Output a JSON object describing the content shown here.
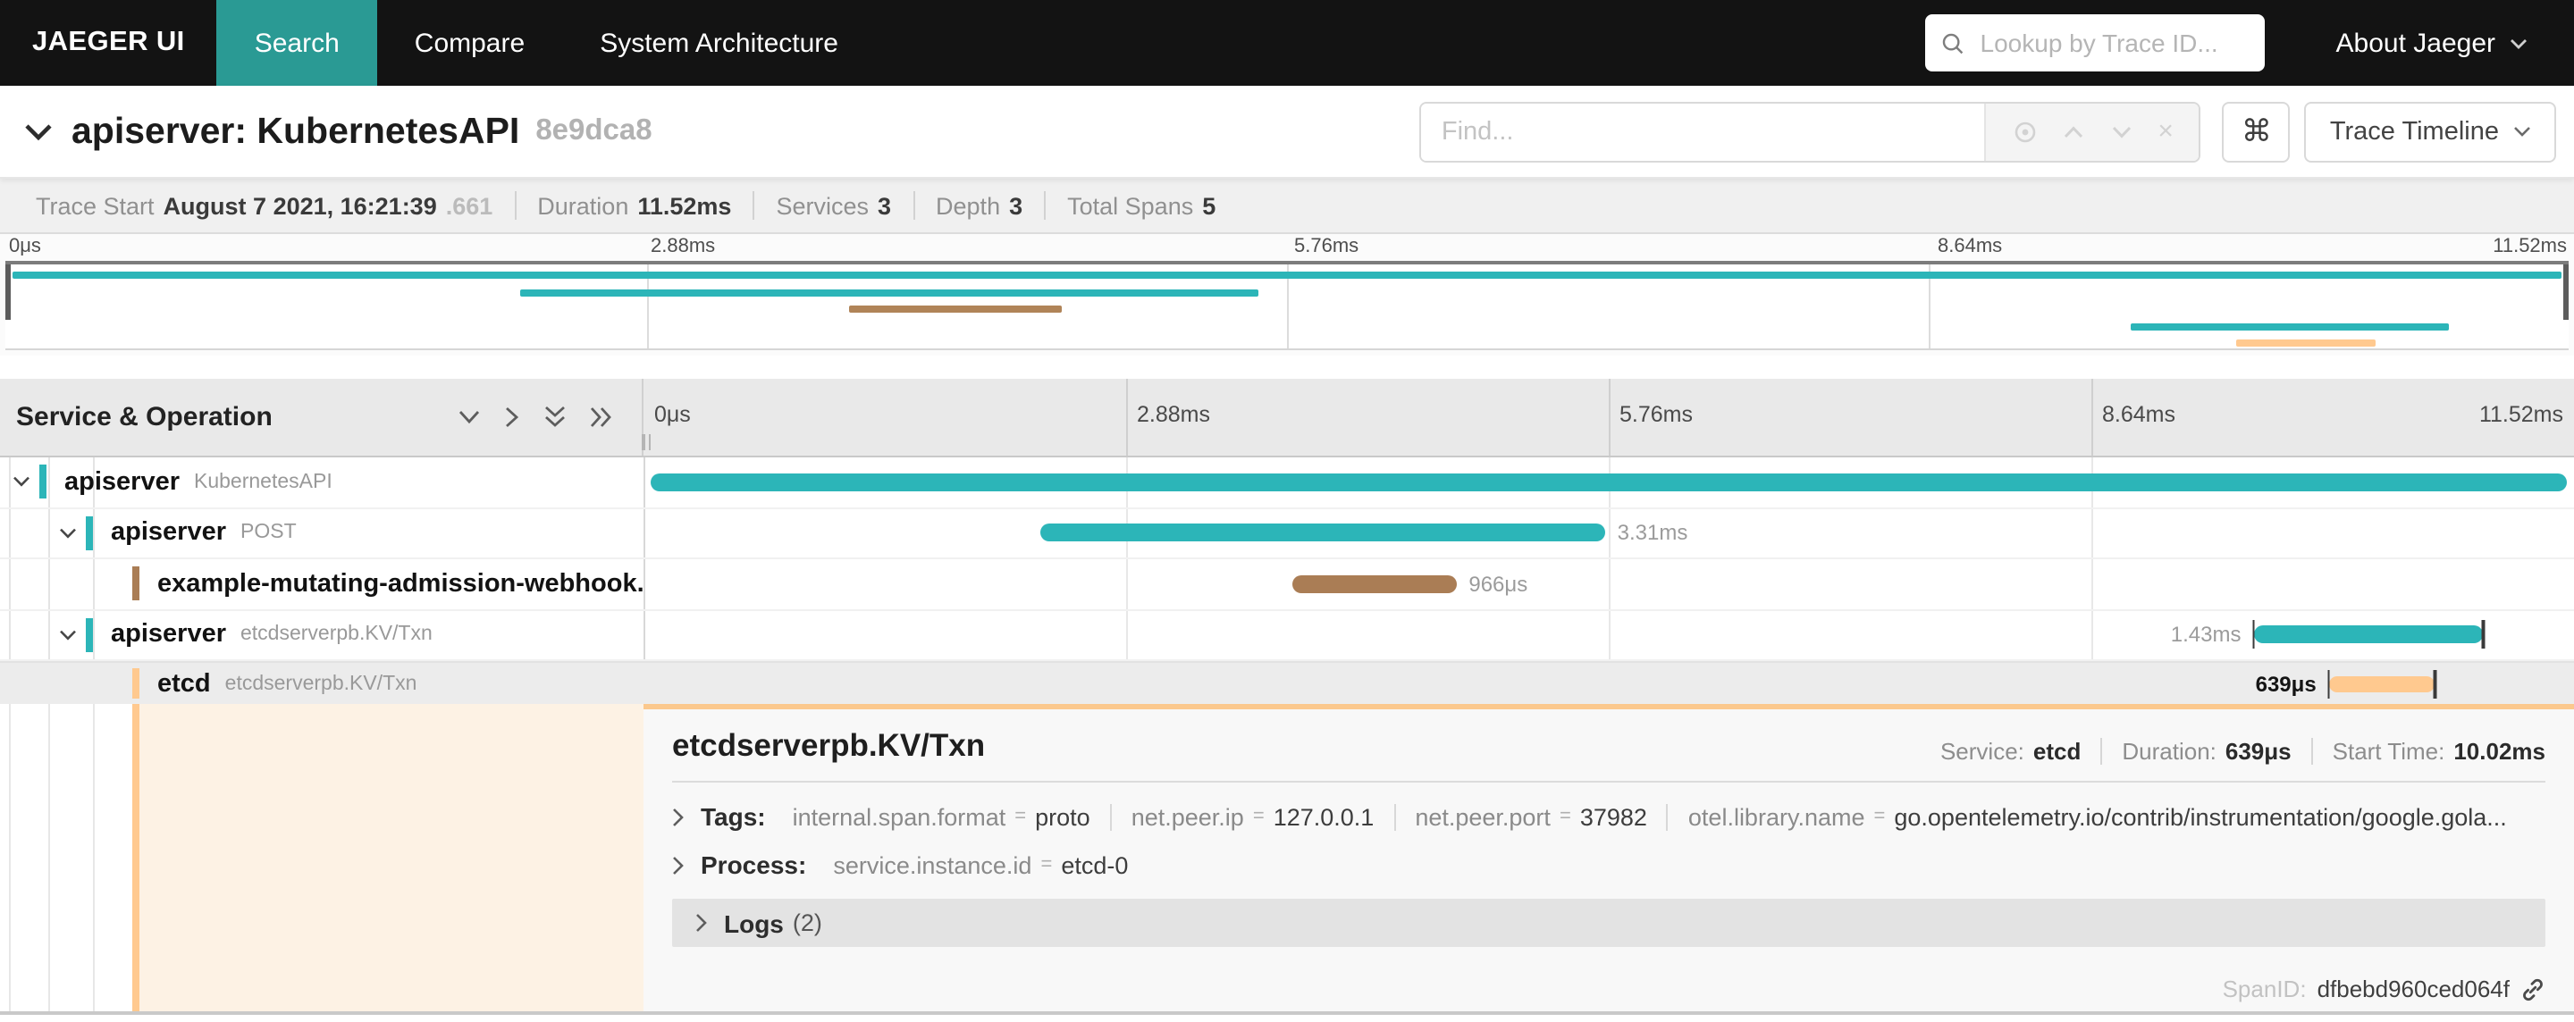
{
  "nav": {
    "brand": "JAEGER UI",
    "tabs": [
      {
        "label": "Search",
        "active": true
      },
      {
        "label": "Compare",
        "active": false
      },
      {
        "label": "System Architecture",
        "active": false
      }
    ],
    "lookup_placeholder": "Lookup by Trace ID...",
    "about_label": "About Jaeger",
    "active_tab_color": "#2a9a94"
  },
  "trace_header": {
    "title": "apiserver: KubernetesAPI",
    "trace_id": "8e9dca8",
    "find_placeholder": "Find...",
    "shortcut_key": "⌘",
    "view_selector_label": "Trace Timeline"
  },
  "stats": {
    "items": [
      {
        "label": "Trace Start",
        "value": "August 7 2021, 16:21:39",
        "extra": ".661"
      },
      {
        "label": "Duration",
        "value": "11.52ms",
        "extra": ""
      },
      {
        "label": "Services",
        "value": "3",
        "extra": ""
      },
      {
        "label": "Depth",
        "value": "3",
        "extra": ""
      },
      {
        "label": "Total Spans",
        "value": "5",
        "extra": ""
      }
    ]
  },
  "minimap": {
    "ticks": [
      "0μs",
      "2.88ms",
      "5.76ms",
      "8.64ms",
      "11.52ms"
    ],
    "bars": [
      {
        "name": "apiserver KubernetesAPI",
        "color": "#2cb5b8",
        "left": 0.3,
        "width": 99.4,
        "row": 0
      },
      {
        "name": "apiserver POST",
        "color": "#2cb5b8",
        "left": 20.1,
        "width": 28.8,
        "row": 1
      },
      {
        "name": "example-mutating-admission-webhook",
        "color": "#b08458",
        "left": 32.9,
        "width": 8.3,
        "row": 2
      },
      {
        "name": "apiserver etcdserverpb.KV/Txn",
        "color": "#2cb5b8",
        "left": 82.9,
        "width": 12.4,
        "row": 3
      },
      {
        "name": "etcd etcdserverpb.KV/Txn",
        "color": "#ffc98f",
        "left": 87.0,
        "width": 5.5,
        "row": 4
      }
    ]
  },
  "timeline": {
    "left_header": "Service & Operation",
    "ticks": [
      "0μs",
      "2.88ms",
      "5.76ms",
      "8.64ms",
      "11.52ms"
    ]
  },
  "spans": [
    {
      "service": "apiserver",
      "operation": "KubernetesAPI",
      "depth": 0,
      "has_children": true,
      "color": "#2cb5b8",
      "bar_left": 0.4,
      "bar_width": 99.2,
      "duration_label": "",
      "label_side": "none",
      "selected": false,
      "end_ticks": false
    },
    {
      "service": "apiserver",
      "operation": "POST",
      "depth": 1,
      "has_children": true,
      "color": "#2cb5b8",
      "bar_left": 20.6,
      "bar_width": 29.2,
      "duration_label": "3.31ms",
      "label_side": "right",
      "selected": false,
      "end_ticks": false
    },
    {
      "service": "example-mutating-admission-webhook...",
      "operation": "",
      "depth": 2,
      "has_children": false,
      "color": "#aa7d55",
      "bar_left": 33.6,
      "bar_width": 8.5,
      "duration_label": "966μs",
      "label_side": "right",
      "selected": false,
      "end_ticks": false
    },
    {
      "service": "apiserver",
      "operation": "etcdserverpb.KV/Txn",
      "depth": 1,
      "has_children": true,
      "color": "#2cb5b8",
      "bar_left": 83.4,
      "bar_width": 11.9,
      "duration_label": "1.43ms",
      "label_side": "left",
      "selected": false,
      "end_ticks": true
    },
    {
      "service": "etcd",
      "operation": "etcdserverpb.KV/Txn",
      "depth": 2,
      "has_children": false,
      "color": "#ffc98f",
      "bar_left": 87.3,
      "bar_width": 5.5,
      "duration_label": "639μs",
      "label_side": "left",
      "selected": true,
      "end_ticks": true
    }
  ],
  "detail": {
    "title": "etcdserverpb.KV/Txn",
    "meta": [
      {
        "label": "Service:",
        "value": "etcd"
      },
      {
        "label": "Duration:",
        "value": "639μs"
      },
      {
        "label": "Start Time:",
        "value": "10.02ms"
      }
    ],
    "tags_label": "Tags:",
    "tags": [
      {
        "key": "internal.span.format",
        "value": "proto"
      },
      {
        "key": "net.peer.ip",
        "value": "127.0.0.1"
      },
      {
        "key": "net.peer.port",
        "value": "37982"
      },
      {
        "key": "otel.library.name",
        "value": "go.opentelemetry.io/contrib/instrumentation/google.gola..."
      }
    ],
    "process_label": "Process:",
    "process": [
      {
        "key": "service.instance.id",
        "value": "etcd-0"
      }
    ],
    "logs_label": "Logs",
    "logs_count": "(2)",
    "span_id_label": "SpanID:",
    "span_id": "dfbebd960ced064f",
    "accent_color": "#fbc88d"
  }
}
